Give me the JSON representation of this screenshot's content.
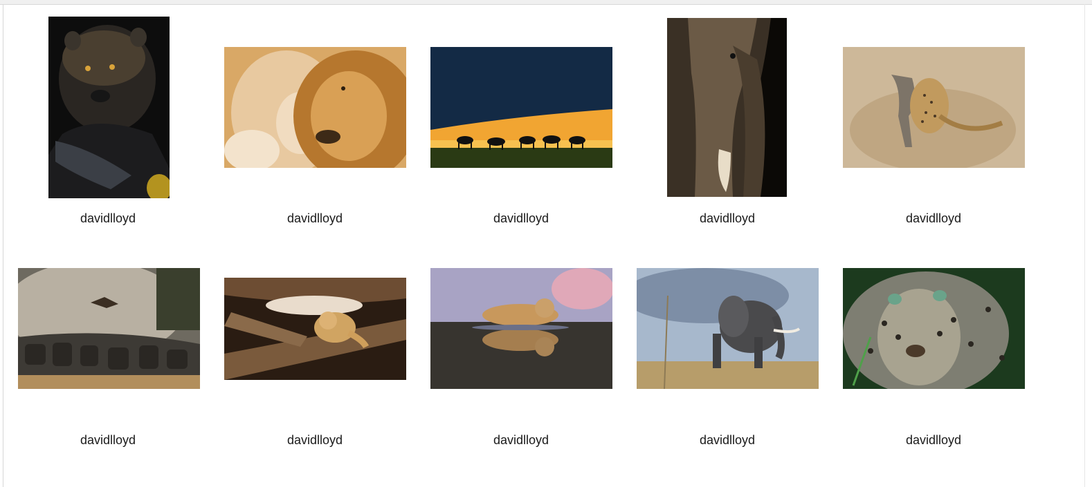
{
  "gallery": {
    "items": [
      {
        "caption": "davidlloyd",
        "icon": "black-panther-photo"
      },
      {
        "caption": "davidlloyd",
        "icon": "lion-pair-photo"
      },
      {
        "caption": "davidlloyd",
        "icon": "antelope-sunset-photo"
      },
      {
        "caption": "davidlloyd",
        "icon": "elephant-closeup-photo"
      },
      {
        "caption": "davidlloyd",
        "icon": "leopard-hunt-photo"
      },
      {
        "caption": "davidlloyd",
        "icon": "wildebeest-herd-photo"
      },
      {
        "caption": "davidlloyd",
        "icon": "lion-cub-photo"
      },
      {
        "caption": "davidlloyd",
        "icon": "lion-reflection-photo"
      },
      {
        "caption": "davidlloyd",
        "icon": "elephant-savanna-photo"
      },
      {
        "caption": "davidlloyd",
        "icon": "leopard-face-photo"
      }
    ]
  },
  "colors": {
    "page_bg": "#ffffff",
    "caption_text": "#1a1a1a"
  }
}
